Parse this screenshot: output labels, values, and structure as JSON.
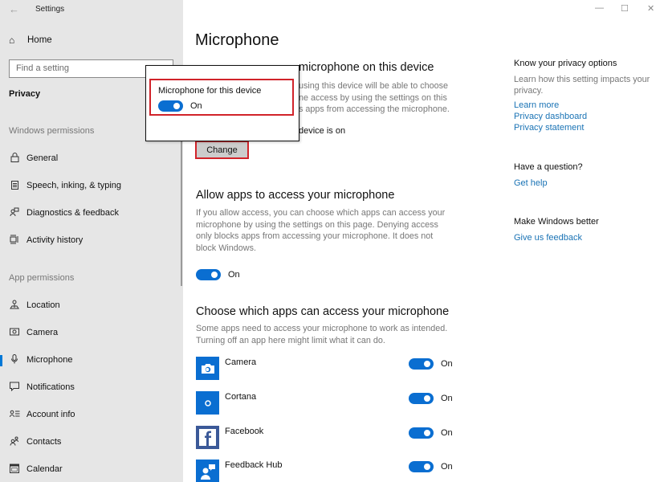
{
  "window": {
    "title": "Settings",
    "controls": {
      "minimize": "—",
      "maximize": "☐",
      "close": "✕"
    }
  },
  "sidebar": {
    "home_label": "Home",
    "search_placeholder": "Find a setting",
    "section_title": "Privacy",
    "groups": [
      {
        "label": "Windows permissions",
        "items": [
          {
            "label": "General",
            "icon": "lock-icon",
            "glyph": "🔒︎"
          },
          {
            "label": "Speech, inking, & typing",
            "icon": "clipboard-icon",
            "glyph": "📋︎"
          },
          {
            "label": "Diagnostics & feedback",
            "icon": "feedback-icon",
            "glyph": "⚐"
          },
          {
            "label": "Activity history",
            "icon": "activity-history-icon",
            "glyph": "☷"
          }
        ]
      },
      {
        "label": "App permissions",
        "items": [
          {
            "label": "Location",
            "icon": "location-icon",
            "glyph": "⚲"
          },
          {
            "label": "Camera",
            "icon": "camera-icon",
            "glyph": "⊡"
          },
          {
            "label": "Microphone",
            "icon": "microphone-icon",
            "glyph": "🎙︎",
            "active": true
          },
          {
            "label": "Notifications",
            "icon": "notifications-icon",
            "glyph": "▭"
          },
          {
            "label": "Account info",
            "icon": "account-info-icon",
            "glyph": "≡"
          },
          {
            "label": "Contacts",
            "icon": "contacts-icon",
            "glyph": "⚇"
          },
          {
            "label": "Calendar",
            "icon": "calendar-icon",
            "glyph": "▦"
          }
        ]
      }
    ]
  },
  "main": {
    "title": "Microphone",
    "device_section": {
      "heading_visible": "microphone on this device",
      "desc_lines": [
        "using this device will be able to choose",
        "ne access by using the settings on this",
        "s apps from accessing the microphone."
      ],
      "status_visible": "device is on",
      "change_button": "Change"
    },
    "allow_section": {
      "heading": "Allow apps to access your microphone",
      "desc": "If you allow access, you can choose which apps can access your microphone by using the settings on this page. Denying access only blocks apps from accessing your microphone. It does not block Windows.",
      "toggle": {
        "state": "On",
        "checked": true
      }
    },
    "choose_section": {
      "heading": "Choose which apps can access your microphone",
      "desc": "Some apps need to access your microphone to work as intended. Turning off an app here might limit what it can do.",
      "apps": [
        {
          "name": "Camera",
          "icon": "camera-app-icon",
          "toggle": "On",
          "checked": true,
          "color": "#0a6ed1"
        },
        {
          "name": "Cortana",
          "icon": "cortana-app-icon",
          "toggle": "On",
          "checked": true,
          "color": "#0a6ed1"
        },
        {
          "name": "Facebook",
          "icon": "facebook-app-icon",
          "toggle": "On",
          "checked": true,
          "color": "#3b5998"
        },
        {
          "name": "Feedback Hub",
          "icon": "feedback-hub-app-icon",
          "toggle": "On",
          "checked": true,
          "color": "#0a6ed1"
        }
      ]
    }
  },
  "popup": {
    "label": "Microphone for this device",
    "toggle": {
      "state": "On",
      "checked": true
    }
  },
  "right": {
    "privacy": {
      "heading": "Know your privacy options",
      "desc": "Learn how this setting impacts your privacy.",
      "links": [
        "Learn more",
        "Privacy dashboard",
        "Privacy statement"
      ]
    },
    "question": {
      "heading": "Have a question?",
      "link": "Get help"
    },
    "better": {
      "heading": "Make Windows better",
      "link": "Give us feedback"
    }
  },
  "colors": {
    "accent": "#0a6ed1",
    "highlight": "#d1232a",
    "link": "#1a73b5",
    "sidebar_bg": "#e6e6e6"
  }
}
